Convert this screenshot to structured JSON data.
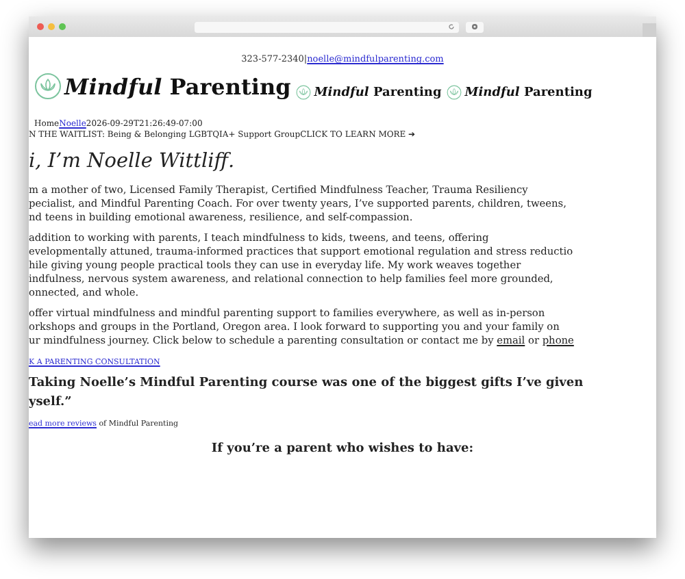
{
  "contact": {
    "phone": "323-577-2340",
    "separator": "|",
    "email": "noelle@mindfulparenting.com"
  },
  "logos": [
    {
      "text": "*Mindful* Parenting",
      "kind": "large"
    },
    {
      "text": "*Mindful* Parenting",
      "kind": "small"
    },
    {
      "text": "*Mindful* Parenting",
      "kind": "small"
    }
  ],
  "breadcrumb": {
    "home": "Home",
    "author": "Noelle",
    "date": "2026-09-29T21:26:49-07:00"
  },
  "banner": {
    "text": "N THE WAITLIST: Being & Belonging LGBTQIA+ Support Group",
    "cta": "CLICK TO LEARN MORE ➔"
  },
  "heading": "i, I’m Noelle Wittliff.",
  "paragraphs": [
    {
      "lines": [
        [
          {
            "kind": "text",
            "text": "m a mother of two, Licensed Family Therapist, Certified Mindfulness Teacher, Trauma Resiliency"
          }
        ],
        [
          {
            "kind": "text",
            "text": "pecialist, and Mindful Parenting Coach. For over twenty years, I’ve supported parents, children, tweens,"
          }
        ],
        [
          {
            "kind": "text",
            "text": "nd teens in building emotional awareness, resilience, and self-compassion."
          }
        ]
      ]
    },
    {
      "lines": [
        [
          {
            "kind": "text",
            "text": "addition to working with parents, I teach mindfulness to kids, tweens, and teens, offering"
          }
        ],
        [
          {
            "kind": "text",
            "text": "evelopmentally attuned, trauma-informed practices that support emotional regulation and stress reductio"
          }
        ],
        [
          {
            "kind": "text",
            "text": "hile giving young people practical tools they can use in everyday life. My work weaves together"
          }
        ],
        [
          {
            "kind": "text",
            "text": "indfulness, nervous system awareness, and relational connection to help families feel more grounded,"
          }
        ],
        [
          {
            "kind": "text",
            "text": "onnected, and whole."
          }
        ]
      ]
    },
    {
      "lines": [
        [
          {
            "kind": "text",
            "text": "offer virtual mindfulness and mindful parenting support to families everywhere, as well as in-person"
          }
        ],
        [
          {
            "kind": "text",
            "text": "orkshops and groups in the Portland, Oregon area. I look forward to supporting you and your family on"
          }
        ],
        [
          {
            "kind": "text",
            "text": "ur mindfulness journey. Click below to schedule a parenting consultation or contact me by "
          },
          {
            "kind": "link",
            "text": "email"
          },
          {
            "kind": "text",
            "text": " or "
          },
          {
            "kind": "link",
            "text": "phone"
          }
        ]
      ]
    }
  ],
  "consultation_link": "K A PARENTING CONSULTATION",
  "quote": {
    "lines": [
      "Taking Noelle’s Mindful Parenting course was one of the biggest gifts I’ve given",
      "yself.”"
    ]
  },
  "reviews": {
    "link": "ead more reviews",
    "text": " of Mindful Parenting"
  },
  "section_heading": "If you’re a parent who wishes to have:"
}
